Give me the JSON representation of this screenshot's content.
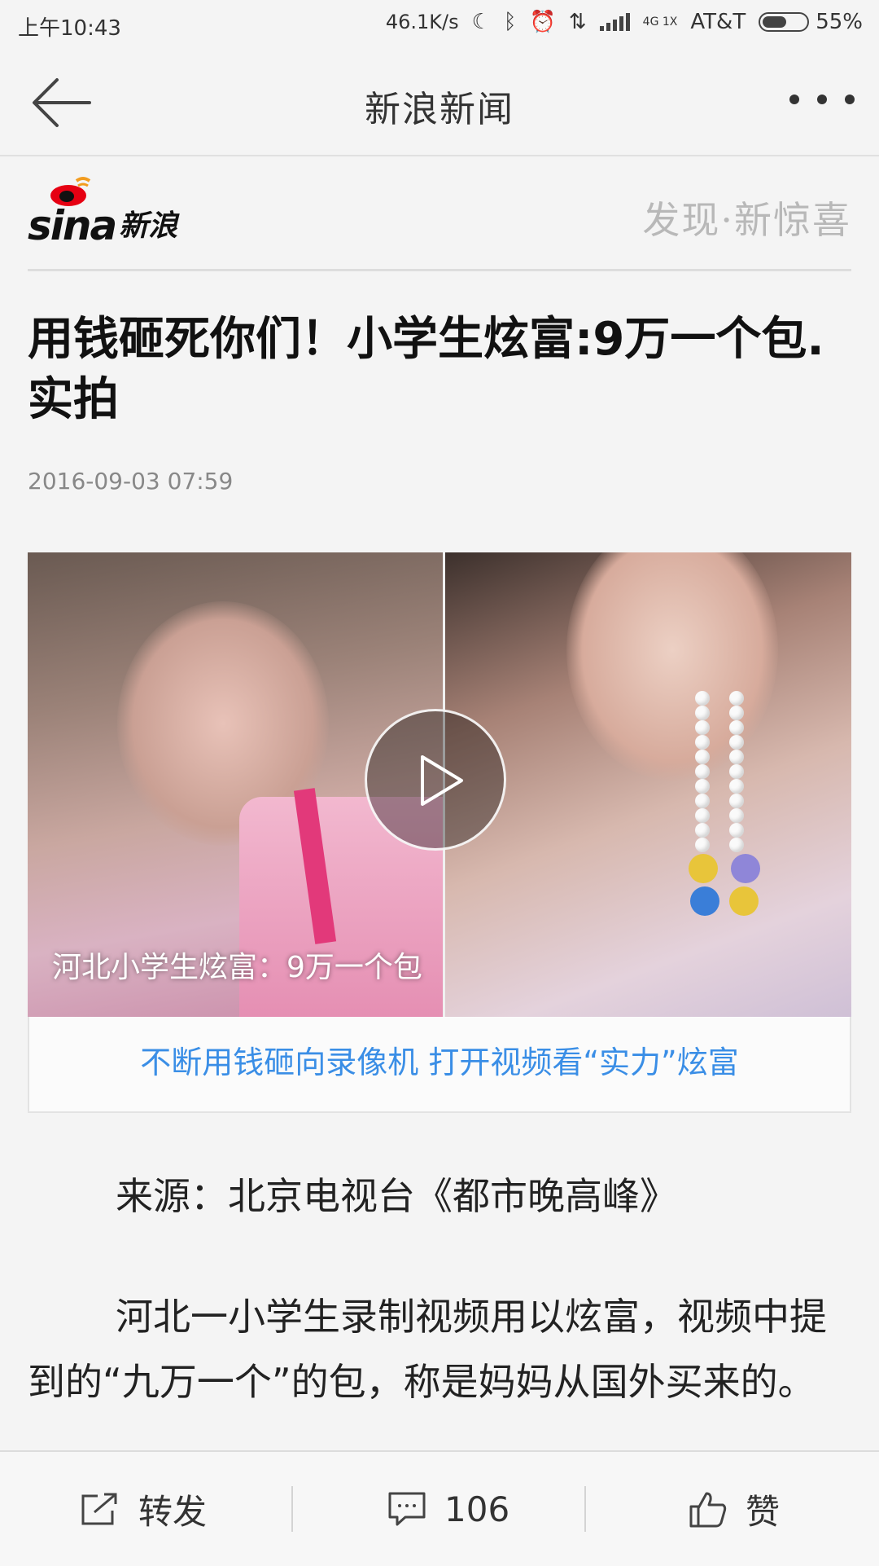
{
  "status_bar": {
    "time": "上午10:43",
    "speed": "46.1K/s",
    "network": "4G 1X",
    "carrier": "AT&T",
    "battery_percent": 55,
    "battery_label": "55%"
  },
  "app_bar": {
    "title": "新浪新闻"
  },
  "brand": {
    "logo_text": "sina",
    "logo_cn": "新浪",
    "slogan": "发现·新惊喜"
  },
  "article": {
    "headline": "用钱砸死你们！小学生炫富:9万一个包.实拍",
    "date": "2016-09-03 07:59",
    "video_caption": "河北小学生炫富：9万一个包",
    "video_link": "不断用钱砸向录像机 打开视频看“实力”炫富",
    "source": "来源：北京电视台《都市晚高峰》",
    "paragraph": "河北一小学生录制视频用以炫富，视频中提到的“九万一个”的包，称是妈妈从国外买来的。"
  },
  "bottom_bar": {
    "share_label": "转发",
    "comment_count": "106",
    "like_label": "赞"
  },
  "colors": {
    "link": "#3a8ee6",
    "background": "#f4f4f4"
  }
}
